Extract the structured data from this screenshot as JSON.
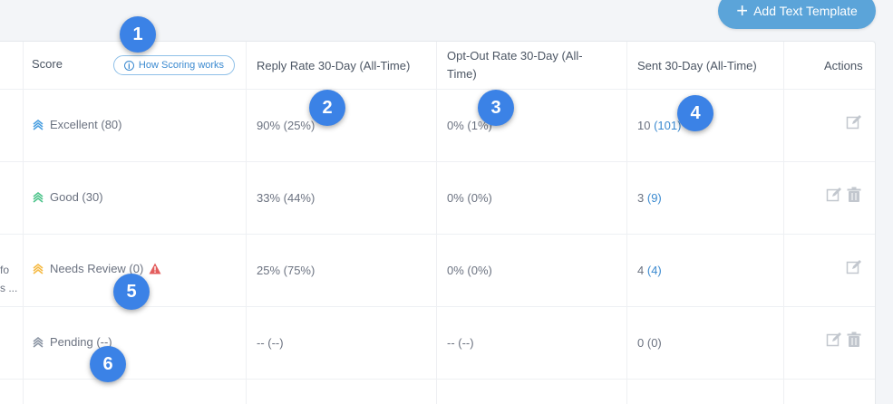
{
  "toolbar": {
    "add_template_label": "Add Text Template"
  },
  "table": {
    "headers": {
      "score": "Score",
      "how_scoring": "How Scoring works",
      "reply_rate": "Reply Rate 30-Day (All-Time)",
      "opt_out_rate": "Opt-Out Rate 30-Day (All-Time)",
      "sent": "Sent 30-Day (All-Time)",
      "actions": "Actions"
    },
    "rows": [
      {
        "score": "Excellent (80)",
        "reply": "90% (25%)",
        "optout": "0% (1%)",
        "sent_30": "10",
        "sent_all": "(101)"
      },
      {
        "score": "Good (30)",
        "reply": "33% (44%)",
        "optout": "0% (0%)",
        "sent_30": "3",
        "sent_all": "(9)"
      },
      {
        "score": "Needs Review (0)",
        "reply": "25% (75%)",
        "optout": "0% (0%)",
        "sent_30": "4",
        "sent_all": "(4)"
      },
      {
        "score": "Pending (--)",
        "reply": "-- (--)",
        "optout": "-- (--)",
        "sent_30": "0",
        "sent_all": "(0)"
      }
    ],
    "clipped_fragments": [
      "fo",
      "s ..."
    ]
  },
  "score_colors": {
    "excellent": "#4a9fe0",
    "good": "#4cc38a",
    "needs_review": "#f5b942",
    "pending": "#8a94a3"
  },
  "icons": {
    "edit": "edit-icon",
    "delete": "trash-icon",
    "info": "info-icon",
    "warning": "warning-icon",
    "score": "chevrons-up-icon"
  },
  "badges": [
    "1",
    "2",
    "3",
    "4",
    "5",
    "6"
  ]
}
